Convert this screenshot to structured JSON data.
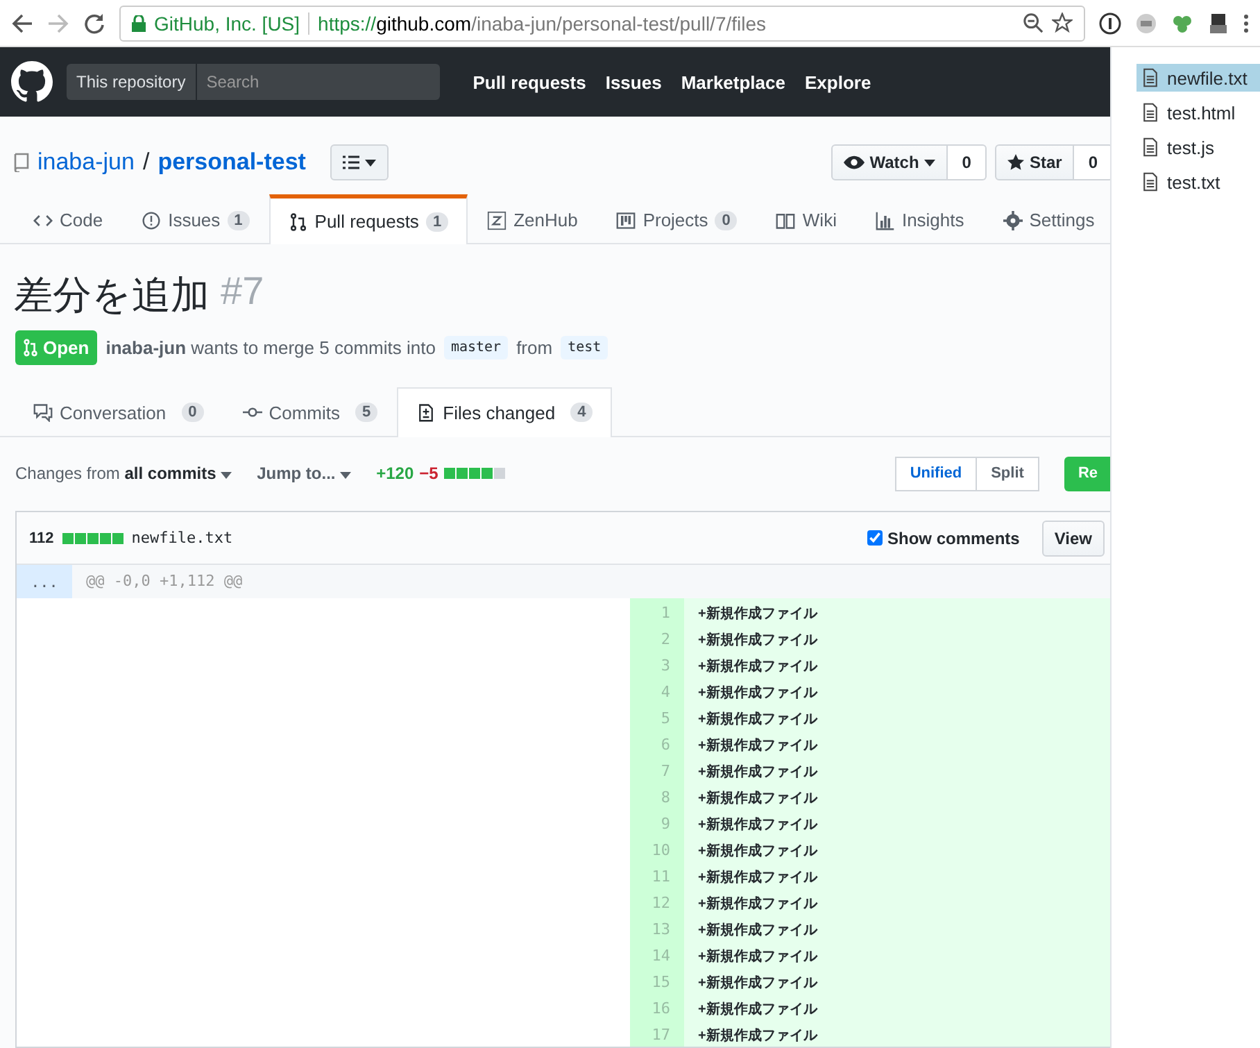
{
  "browser": {
    "secure_label": "GitHub, Inc. [US]",
    "url_scheme": "https://",
    "url_host": "github.com",
    "url_path": "/inaba-jun/personal-test/pull/7/files"
  },
  "header": {
    "scope": "This repository",
    "search_placeholder": "Search",
    "nav": [
      "Pull requests",
      "Issues",
      "Marketplace",
      "Explore"
    ]
  },
  "repo": {
    "owner": "inaba-jun",
    "separator": "/",
    "name": "personal-test",
    "watch": {
      "label": "Watch",
      "count": "0"
    },
    "star": {
      "label": "Star",
      "count": "0"
    }
  },
  "repo_tabs": [
    {
      "label": "Code",
      "selected": false
    },
    {
      "label": "Issues",
      "count": "1",
      "selected": false
    },
    {
      "label": "Pull requests",
      "count": "1",
      "selected": true
    },
    {
      "label": "ZenHub",
      "selected": false
    },
    {
      "label": "Projects",
      "count": "0",
      "selected": false
    },
    {
      "label": "Wiki",
      "selected": false
    },
    {
      "label": "Insights",
      "selected": false
    },
    {
      "label": "Settings",
      "selected": false
    }
  ],
  "pr": {
    "title": "差分を追加",
    "number": "#7",
    "state": "Open",
    "author": "inaba-jun",
    "summary": "wants to merge 5 commits into",
    "base": "master",
    "from": "from",
    "head": "test"
  },
  "pr_tabs": [
    {
      "label": "Conversation",
      "count": "0",
      "selected": false
    },
    {
      "label": "Commits",
      "count": "5",
      "selected": false
    },
    {
      "label": "Files changed",
      "count": "4",
      "selected": true
    }
  ],
  "toolbar": {
    "changes_prefix": "Changes from",
    "changes_value": "all commits",
    "jump": "Jump to...",
    "additions": "+120",
    "deletions": "−5",
    "diffstat": [
      {
        "kind": "added"
      },
      {
        "kind": "added"
      },
      {
        "kind": "added"
      },
      {
        "kind": "added"
      },
      {
        "kind": "neutral"
      }
    ],
    "view_modes": [
      {
        "label": "Unified",
        "selected": true
      },
      {
        "label": "Split",
        "selected": false
      }
    ],
    "review": "Re"
  },
  "file": {
    "count": "112",
    "diffstat": [
      {
        "kind": "added"
      },
      {
        "kind": "added"
      },
      {
        "kind": "added"
      },
      {
        "kind": "added"
      },
      {
        "kind": "added"
      }
    ],
    "name": "newfile.txt",
    "show_comments": {
      "label": "Show comments",
      "checked": true
    },
    "view": "View",
    "expander": "...",
    "hunk": "@@ -0,0 +1,112 @@",
    "lines": [
      {
        "number": "1",
        "text": "+新規作成ファイル"
      },
      {
        "number": "2",
        "text": "+新規作成ファイル"
      },
      {
        "number": "3",
        "text": "+新規作成ファイル"
      },
      {
        "number": "4",
        "text": "+新規作成ファイル"
      },
      {
        "number": "5",
        "text": "+新規作成ファイル"
      },
      {
        "number": "6",
        "text": "+新規作成ファイル"
      },
      {
        "number": "7",
        "text": "+新規作成ファイル"
      },
      {
        "number": "8",
        "text": "+新規作成ファイル"
      },
      {
        "number": "9",
        "text": "+新規作成ファイル"
      },
      {
        "number": "10",
        "text": "+新規作成ファイル"
      },
      {
        "number": "11",
        "text": "+新規作成ファイル"
      },
      {
        "number": "12",
        "text": "+新規作成ファイル"
      },
      {
        "number": "13",
        "text": "+新規作成ファイル"
      },
      {
        "number": "14",
        "text": "+新規作成ファイル"
      },
      {
        "number": "15",
        "text": "+新規作成ファイル"
      },
      {
        "number": "16",
        "text": "+新規作成ファイル"
      },
      {
        "number": "17",
        "text": "+新規作成ファイル"
      }
    ]
  },
  "file_list": [
    {
      "name": "newfile.txt",
      "selected": true
    },
    {
      "name": "test.html",
      "selected": false
    },
    {
      "name": "test.js",
      "selected": false
    },
    {
      "name": "test.txt",
      "selected": false
    }
  ]
}
